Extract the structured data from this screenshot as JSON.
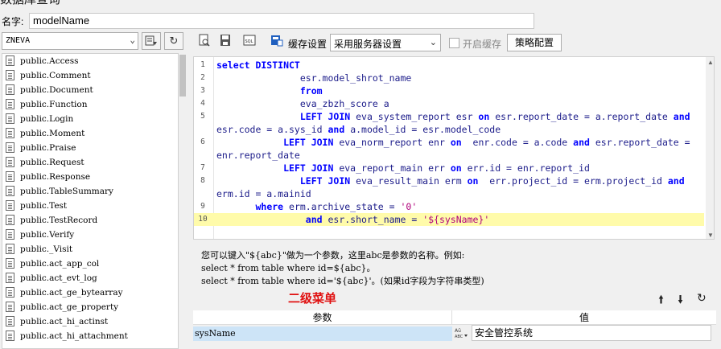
{
  "window": {
    "title": "数据库查询",
    "close_glyph": "×"
  },
  "name_field": {
    "label": "名字:",
    "value": "modelName"
  },
  "left_pane": {
    "datasource": "ZNEVA",
    "tables": [
      "public.Access",
      "public.Comment",
      "public.Document",
      "public.Function",
      "public.Login",
      "public.Moment",
      "public.Praise",
      "public.Request",
      "public.Response",
      "public.TableSummary",
      "public.Test",
      "public.TestRecord",
      "public.Verify",
      "public._Visit",
      "public.act_app_col",
      "public.act_evt_log",
      "public.act_ge_bytearray",
      "public.act_ge_property",
      "public.act_hi_actinst",
      "public.act_hi_attachment"
    ]
  },
  "toolbar": {
    "cache_label": "缓存设置",
    "cache_option": "采用服务器设置",
    "enable_cache_label": "开启缓存",
    "strategy_button": "策略配置"
  },
  "editor": {
    "lines": [
      {
        "no": "1",
        "cont": false,
        "tokens": [
          [
            "kw",
            "select DISTINCT"
          ]
        ]
      },
      {
        "no": "2",
        "cont": false,
        "tokens": [
          [
            "t",
            "               esr.model_shrot_name"
          ]
        ]
      },
      {
        "no": "3",
        "cont": false,
        "tokens": [
          [
            "t",
            "               "
          ],
          [
            "kw",
            "from"
          ]
        ]
      },
      {
        "no": "4",
        "cont": false,
        "tokens": [
          [
            "t",
            "               eva_zbzh_score a"
          ]
        ]
      },
      {
        "no": "5",
        "cont": false,
        "tokens": [
          [
            "t",
            "               "
          ],
          [
            "kw",
            "LEFT JOIN"
          ],
          [
            "t",
            " eva_system_report esr "
          ],
          [
            "kw",
            "on"
          ],
          [
            "t",
            " esr.report_date = a.report_date "
          ],
          [
            "kw",
            "and"
          ]
        ]
      },
      {
        "no": "",
        "cont": true,
        "tokens": [
          [
            "t",
            "esr.code = a.sys_id "
          ],
          [
            "kw",
            "and"
          ],
          [
            "t",
            " a.model_id = esr.model_code"
          ]
        ]
      },
      {
        "no": "6",
        "cont": false,
        "tokens": [
          [
            "t",
            "            "
          ],
          [
            "kw",
            "LEFT JOIN"
          ],
          [
            "t",
            " eva_norm_report enr "
          ],
          [
            "kw",
            "on"
          ],
          [
            "t",
            "  enr.code = a.code "
          ],
          [
            "kw",
            "and"
          ],
          [
            "t",
            " esr.report_date ="
          ]
        ]
      },
      {
        "no": "",
        "cont": true,
        "tokens": [
          [
            "t",
            "enr.report_date"
          ]
        ]
      },
      {
        "no": "7",
        "cont": false,
        "tokens": [
          [
            "t",
            "            "
          ],
          [
            "kw",
            "LEFT JOIN"
          ],
          [
            "t",
            " eva_report_main err "
          ],
          [
            "kw",
            "on"
          ],
          [
            "t",
            " err.id = enr.report_id"
          ]
        ]
      },
      {
        "no": "8",
        "cont": false,
        "tokens": [
          [
            "t",
            "               "
          ],
          [
            "kw",
            "LEFT JOIN"
          ],
          [
            "t",
            " eva_result_main erm "
          ],
          [
            "kw",
            "on"
          ],
          [
            "t",
            "  err.project_id = erm.project_id "
          ],
          [
            "kw",
            "and"
          ]
        ]
      },
      {
        "no": "",
        "cont": true,
        "tokens": [
          [
            "t",
            "erm.id = a.mainid"
          ]
        ]
      },
      {
        "no": "9",
        "cont": false,
        "tokens": [
          [
            "t",
            "       "
          ],
          [
            "kw",
            "where"
          ],
          [
            "t",
            " erm.archive_state = "
          ],
          [
            "str",
            "'0'"
          ]
        ]
      },
      {
        "no": "10",
        "cont": false,
        "highlight": true,
        "tokens": [
          [
            "t",
            "                "
          ],
          [
            "kw",
            "and"
          ],
          [
            "t",
            " esr.short_name = "
          ],
          [
            "str",
            "'${sysName}'"
          ]
        ]
      }
    ]
  },
  "hint": {
    "line1": "您可以键入\"${abc}\"做为一个参数，这里abc是参数的名称。例如:",
    "line2": "select * from table where id=${abc}。",
    "line3": "select * from table where id='${abc}'。(如果id字段为字符串类型)"
  },
  "sub_menu_label": "二级菜单",
  "params": {
    "col_param": "参数",
    "col_value": "值",
    "rows": [
      {
        "name": "sysName",
        "value": "安全管控系统"
      }
    ]
  },
  "icons": {
    "refresh": "refresh-icon",
    "up": "arrow-up-icon",
    "down": "arrow-down-icon"
  }
}
